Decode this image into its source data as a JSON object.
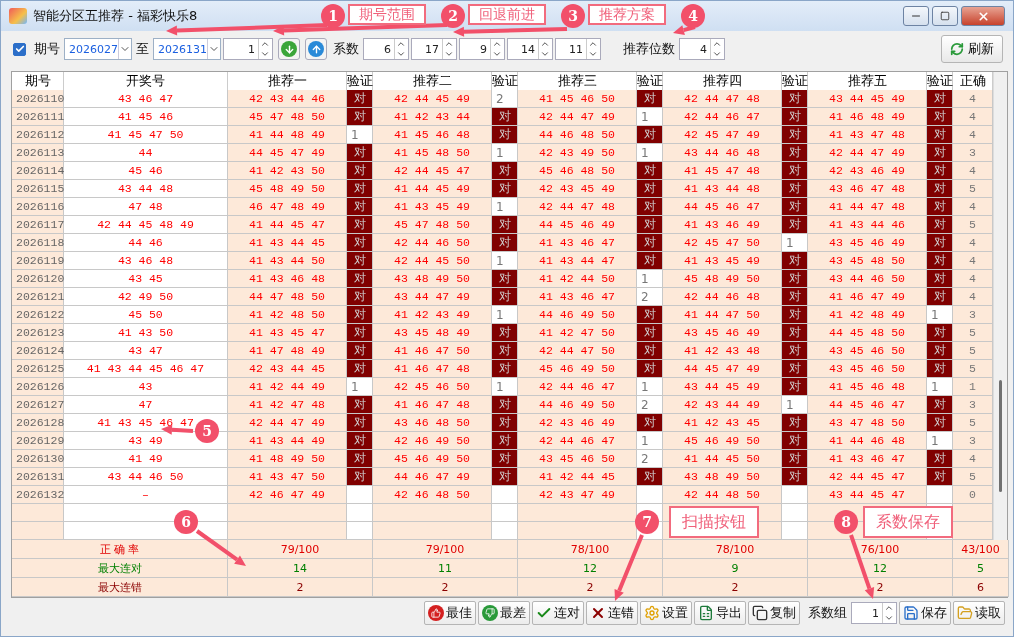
{
  "window": {
    "title": "智能分区五推荐 - 福彩快乐8"
  },
  "toolbar": {
    "period_checkbox": {
      "label": "期号",
      "checked": true
    },
    "from": "2026027",
    "to_label": "至",
    "to": "2026131",
    "step": "1",
    "coef_label": "系数",
    "coefficients": [
      "6",
      "17",
      "9",
      "14",
      "11"
    ],
    "digits_label": "推荐位数",
    "digits": "4",
    "refresh": "刷新"
  },
  "table": {
    "columns": [
      "期号",
      "开奖号",
      "推荐一",
      "验证",
      "推荐二",
      "验证",
      "推荐三",
      "验证",
      "推荐四",
      "验证",
      "推荐五",
      "验证",
      "正确"
    ],
    "rows": [
      {
        "period": "2026110",
        "draw": "43 46 47",
        "recs": [
          {
            "numbers": "42 43 44 46",
            "check": "对",
            "hit": true
          },
          {
            "numbers": "42 44 45 49",
            "check": "2",
            "hit": false
          },
          {
            "numbers": "41 45 46 50",
            "check": "对",
            "hit": true
          },
          {
            "numbers": "42 44 47 48",
            "check": "对",
            "hit": true
          },
          {
            "numbers": "43 44 45 49",
            "check": "对",
            "hit": true
          }
        ],
        "correct": "4"
      },
      {
        "period": "2026111",
        "draw": "41 45 46",
        "recs": [
          {
            "numbers": "45 47 48 50",
            "check": "对",
            "hit": true
          },
          {
            "numbers": "41 42 43 44",
            "check": "对",
            "hit": true
          },
          {
            "numbers": "42 44 47 49",
            "check": "1",
            "hit": false
          },
          {
            "numbers": "42 44 46 47",
            "check": "对",
            "hit": true
          },
          {
            "numbers": "41 46 48 49",
            "check": "对",
            "hit": true
          }
        ],
        "correct": "4"
      },
      {
        "period": "2026112",
        "draw": "41 45 47 50",
        "recs": [
          {
            "numbers": "41 44 48 49",
            "check": "1",
            "hit": false
          },
          {
            "numbers": "41 45 46 48",
            "check": "对",
            "hit": true
          },
          {
            "numbers": "44 46 48 50",
            "check": "对",
            "hit": true
          },
          {
            "numbers": "42 45 47 49",
            "check": "对",
            "hit": true
          },
          {
            "numbers": "41 43 47 48",
            "check": "对",
            "hit": true
          }
        ],
        "correct": "4"
      },
      {
        "period": "2026113",
        "draw": "44",
        "recs": [
          {
            "numbers": "44 45 47 49",
            "check": "对",
            "hit": true
          },
          {
            "numbers": "41 45 48 50",
            "check": "1",
            "hit": false
          },
          {
            "numbers": "42 43 49 50",
            "check": "1",
            "hit": false
          },
          {
            "numbers": "43 44 46 48",
            "check": "对",
            "hit": true
          },
          {
            "numbers": "42 44 47 49",
            "check": "对",
            "hit": true
          }
        ],
        "correct": "3"
      },
      {
        "period": "2026114",
        "draw": "45 46",
        "recs": [
          {
            "numbers": "41 42 43 50",
            "check": "对",
            "hit": true
          },
          {
            "numbers": "42 44 45 47",
            "check": "对",
            "hit": true
          },
          {
            "numbers": "45 46 48 50",
            "check": "对",
            "hit": true
          },
          {
            "numbers": "41 45 47 48",
            "check": "对",
            "hit": true
          },
          {
            "numbers": "42 43 46 49",
            "check": "对",
            "hit": true
          }
        ],
        "correct": "4"
      },
      {
        "period": "2026115",
        "draw": "43 44 48",
        "recs": [
          {
            "numbers": "45 48 49 50",
            "check": "对",
            "hit": true
          },
          {
            "numbers": "41 44 45 49",
            "check": "对",
            "hit": true
          },
          {
            "numbers": "42 43 45 49",
            "check": "对",
            "hit": true
          },
          {
            "numbers": "41 43 44 48",
            "check": "对",
            "hit": true
          },
          {
            "numbers": "43 46 47 48",
            "check": "对",
            "hit": true
          }
        ],
        "correct": "5"
      },
      {
        "period": "2026116",
        "draw": "47 48",
        "recs": [
          {
            "numbers": "46 47 48 49",
            "check": "对",
            "hit": true
          },
          {
            "numbers": "41 43 45 49",
            "check": "1",
            "hit": false
          },
          {
            "numbers": "42 44 47 48",
            "check": "对",
            "hit": true
          },
          {
            "numbers": "44 45 46 47",
            "check": "对",
            "hit": true
          },
          {
            "numbers": "41 44 47 48",
            "check": "对",
            "hit": true
          }
        ],
        "correct": "4"
      },
      {
        "period": "2026117",
        "draw": "42 44 45 48 49",
        "recs": [
          {
            "numbers": "41 44 45 47",
            "check": "对",
            "hit": true
          },
          {
            "numbers": "45 47 48 50",
            "check": "对",
            "hit": true
          },
          {
            "numbers": "44 45 46 49",
            "check": "对",
            "hit": true
          },
          {
            "numbers": "41 43 46 49",
            "check": "对",
            "hit": true
          },
          {
            "numbers": "41 43 44 46",
            "check": "对",
            "hit": true
          }
        ],
        "correct": "5"
      },
      {
        "period": "2026118",
        "draw": "44 46",
        "recs": [
          {
            "numbers": "41 43 44 45",
            "check": "对",
            "hit": true
          },
          {
            "numbers": "42 44 46 50",
            "check": "对",
            "hit": true
          },
          {
            "numbers": "41 43 46 47",
            "check": "对",
            "hit": true
          },
          {
            "numbers": "42 45 47 50",
            "check": "1",
            "hit": false
          },
          {
            "numbers": "43 45 46 49",
            "check": "对",
            "hit": true
          }
        ],
        "correct": "4"
      },
      {
        "period": "2026119",
        "draw": "43 46 48",
        "recs": [
          {
            "numbers": "41 43 44 50",
            "check": "对",
            "hit": true
          },
          {
            "numbers": "42 44 45 50",
            "check": "1",
            "hit": false
          },
          {
            "numbers": "41 43 44 47",
            "check": "对",
            "hit": true
          },
          {
            "numbers": "41 43 45 49",
            "check": "对",
            "hit": true
          },
          {
            "numbers": "43 45 48 50",
            "check": "对",
            "hit": true
          }
        ],
        "correct": "4"
      },
      {
        "period": "2026120",
        "draw": "43 45",
        "recs": [
          {
            "numbers": "41 43 46 48",
            "check": "对",
            "hit": true
          },
          {
            "numbers": "43 48 49 50",
            "check": "对",
            "hit": true
          },
          {
            "numbers": "41 42 44 50",
            "check": "1",
            "hit": false
          },
          {
            "numbers": "45 48 49 50",
            "check": "对",
            "hit": true
          },
          {
            "numbers": "43 44 46 50",
            "check": "对",
            "hit": true
          }
        ],
        "correct": "4"
      },
      {
        "period": "2026121",
        "draw": "42 49 50",
        "recs": [
          {
            "numbers": "44 47 48 50",
            "check": "对",
            "hit": true
          },
          {
            "numbers": "43 44 47 49",
            "check": "对",
            "hit": true
          },
          {
            "numbers": "41 43 46 47",
            "check": "2",
            "hit": false
          },
          {
            "numbers": "42 44 46 48",
            "check": "对",
            "hit": true
          },
          {
            "numbers": "41 46 47 49",
            "check": "对",
            "hit": true
          }
        ],
        "correct": "4"
      },
      {
        "period": "2026122",
        "draw": "45 50",
        "recs": [
          {
            "numbers": "41 42 48 50",
            "check": "对",
            "hit": true
          },
          {
            "numbers": "41 42 43 49",
            "check": "1",
            "hit": false
          },
          {
            "numbers": "44 46 49 50",
            "check": "对",
            "hit": true
          },
          {
            "numbers": "41 44 47 50",
            "check": "对",
            "hit": true
          },
          {
            "numbers": "41 42 48 49",
            "check": "1",
            "hit": false
          }
        ],
        "correct": "3"
      },
      {
        "period": "2026123",
        "draw": "41 43 50",
        "recs": [
          {
            "numbers": "41 43 45 47",
            "check": "对",
            "hit": true
          },
          {
            "numbers": "43 45 48 49",
            "check": "对",
            "hit": true
          },
          {
            "numbers": "41 42 47 50",
            "check": "对",
            "hit": true
          },
          {
            "numbers": "43 45 46 49",
            "check": "对",
            "hit": true
          },
          {
            "numbers": "44 45 48 50",
            "check": "对",
            "hit": true
          }
        ],
        "correct": "5"
      },
      {
        "period": "2026124",
        "draw": "43 47",
        "recs": [
          {
            "numbers": "41 47 48 49",
            "check": "对",
            "hit": true
          },
          {
            "numbers": "41 46 47 50",
            "check": "对",
            "hit": true
          },
          {
            "numbers": "42 44 47 50",
            "check": "对",
            "hit": true
          },
          {
            "numbers": "41 42 43 48",
            "check": "对",
            "hit": true
          },
          {
            "numbers": "43 45 46 50",
            "check": "对",
            "hit": true
          }
        ],
        "correct": "5"
      },
      {
        "period": "2026125",
        "draw": "41 43 44 45 46 47",
        "recs": [
          {
            "numbers": "42 43 44 45",
            "check": "对",
            "hit": true
          },
          {
            "numbers": "41 46 47 48",
            "check": "对",
            "hit": true
          },
          {
            "numbers": "45 46 49 50",
            "check": "对",
            "hit": true
          },
          {
            "numbers": "44 45 47 49",
            "check": "对",
            "hit": true
          },
          {
            "numbers": "43 45 46 50",
            "check": "对",
            "hit": true
          }
        ],
        "correct": "5"
      },
      {
        "period": "2026126",
        "draw": "43",
        "recs": [
          {
            "numbers": "41 42 44 49",
            "check": "1",
            "hit": false
          },
          {
            "numbers": "42 45 46 50",
            "check": "1",
            "hit": false
          },
          {
            "numbers": "42 44 46 47",
            "check": "1",
            "hit": false
          },
          {
            "numbers": "43 44 45 49",
            "check": "对",
            "hit": true
          },
          {
            "numbers": "41 45 46 48",
            "check": "1",
            "hit": false
          }
        ],
        "correct": "1"
      },
      {
        "period": "2026127",
        "draw": "47",
        "recs": [
          {
            "numbers": "41 42 47 48",
            "check": "对",
            "hit": true
          },
          {
            "numbers": "41 46 47 48",
            "check": "对",
            "hit": true
          },
          {
            "numbers": "44 46 49 50",
            "check": "2",
            "hit": false
          },
          {
            "numbers": "42 43 44 49",
            "check": "1",
            "hit": false
          },
          {
            "numbers": "44 45 46 47",
            "check": "对",
            "hit": true
          }
        ],
        "correct": "3"
      },
      {
        "period": "2026128",
        "draw": "41 43 45 46 47",
        "recs": [
          {
            "numbers": "42 44 47 49",
            "check": "对",
            "hit": true
          },
          {
            "numbers": "43 46 48 50",
            "check": "对",
            "hit": true
          },
          {
            "numbers": "42 43 46 49",
            "check": "对",
            "hit": true
          },
          {
            "numbers": "41 42 43 45",
            "check": "对",
            "hit": true
          },
          {
            "numbers": "43 47 48 50",
            "check": "对",
            "hit": true
          }
        ],
        "correct": "5"
      },
      {
        "period": "2026129",
        "draw": "43 49",
        "recs": [
          {
            "numbers": "41 43 44 49",
            "check": "对",
            "hit": true
          },
          {
            "numbers": "42 46 49 50",
            "check": "对",
            "hit": true
          },
          {
            "numbers": "42 44 46 47",
            "check": "1",
            "hit": false
          },
          {
            "numbers": "45 46 49 50",
            "check": "对",
            "hit": true
          },
          {
            "numbers": "41 44 46 48",
            "check": "1",
            "hit": false
          }
        ],
        "correct": "3"
      },
      {
        "period": "2026130",
        "draw": "41 49",
        "recs": [
          {
            "numbers": "41 48 49 50",
            "check": "对",
            "hit": true
          },
          {
            "numbers": "45 46 49 50",
            "check": "对",
            "hit": true
          },
          {
            "numbers": "43 45 46 50",
            "check": "2",
            "hit": false
          },
          {
            "numbers": "41 44 45 50",
            "check": "对",
            "hit": true
          },
          {
            "numbers": "41 43 46 47",
            "check": "对",
            "hit": true
          }
        ],
        "correct": "4"
      },
      {
        "period": "2026131",
        "draw": "43 44 46 50",
        "recs": [
          {
            "numbers": "41 43 47 50",
            "check": "对",
            "hit": true
          },
          {
            "numbers": "44 46 47 49",
            "check": "对",
            "hit": true
          },
          {
            "numbers": "41 42 44 45",
            "check": "对",
            "hit": true
          },
          {
            "numbers": "43 48 49 50",
            "check": "对",
            "hit": true
          },
          {
            "numbers": "42 44 45 47",
            "check": "对",
            "hit": true
          }
        ],
        "correct": "5"
      },
      {
        "period": "2026132",
        "draw": "–",
        "recs": [
          {
            "numbers": "42 46 47 49",
            "hit": false
          },
          {
            "numbers": "42 46 48 50",
            "hit": false
          },
          {
            "numbers": "42 43 47 49",
            "hit": false
          },
          {
            "numbers": "42 44 48 50",
            "hit": false
          },
          {
            "numbers": "43 44 45 47",
            "hit": false
          }
        ],
        "correct": "0"
      }
    ]
  },
  "footer": [
    {
      "label": "正 确 率",
      "kind": "rate",
      "values": [
        "79/100",
        "79/100",
        "78/100",
        "78/100",
        "76/100",
        "43/100"
      ]
    },
    {
      "label": "最大连对",
      "kind": "max_hit",
      "values": [
        "14",
        "11",
        "12",
        "9",
        "12",
        "5"
      ]
    },
    {
      "label": "最大连错",
      "kind": "max_miss",
      "values": [
        "2",
        "2",
        "2",
        "2",
        "2",
        "6"
      ]
    }
  ],
  "bottom_bar": {
    "buttons": [
      {
        "label": "最佳",
        "kind": "best"
      },
      {
        "label": "最差",
        "kind": "worst"
      },
      {
        "label": "连对",
        "kind": "streak_hit"
      },
      {
        "label": "连错",
        "kind": "streak_miss"
      },
      {
        "label": "设置",
        "kind": "settings"
      },
      {
        "label": "导出",
        "kind": "export"
      },
      {
        "label": "复制",
        "kind": "copy"
      }
    ],
    "group_label": "系数组",
    "group": "1",
    "actions": [
      {
        "label": "保存",
        "kind": "save"
      },
      {
        "label": "读取",
        "kind": "load"
      }
    ]
  },
  "annotations": [
    {
      "number": "1",
      "label": "期号范围"
    },
    {
      "number": "2",
      "label": "回退前进"
    },
    {
      "number": "3",
      "label": "推荐方案"
    },
    {
      "number": "4"
    },
    {
      "number": "5"
    },
    {
      "number": "6"
    },
    {
      "number": "7",
      "label": "扫描按钮"
    },
    {
      "number": "8",
      "label": "系数保存"
    }
  ]
}
